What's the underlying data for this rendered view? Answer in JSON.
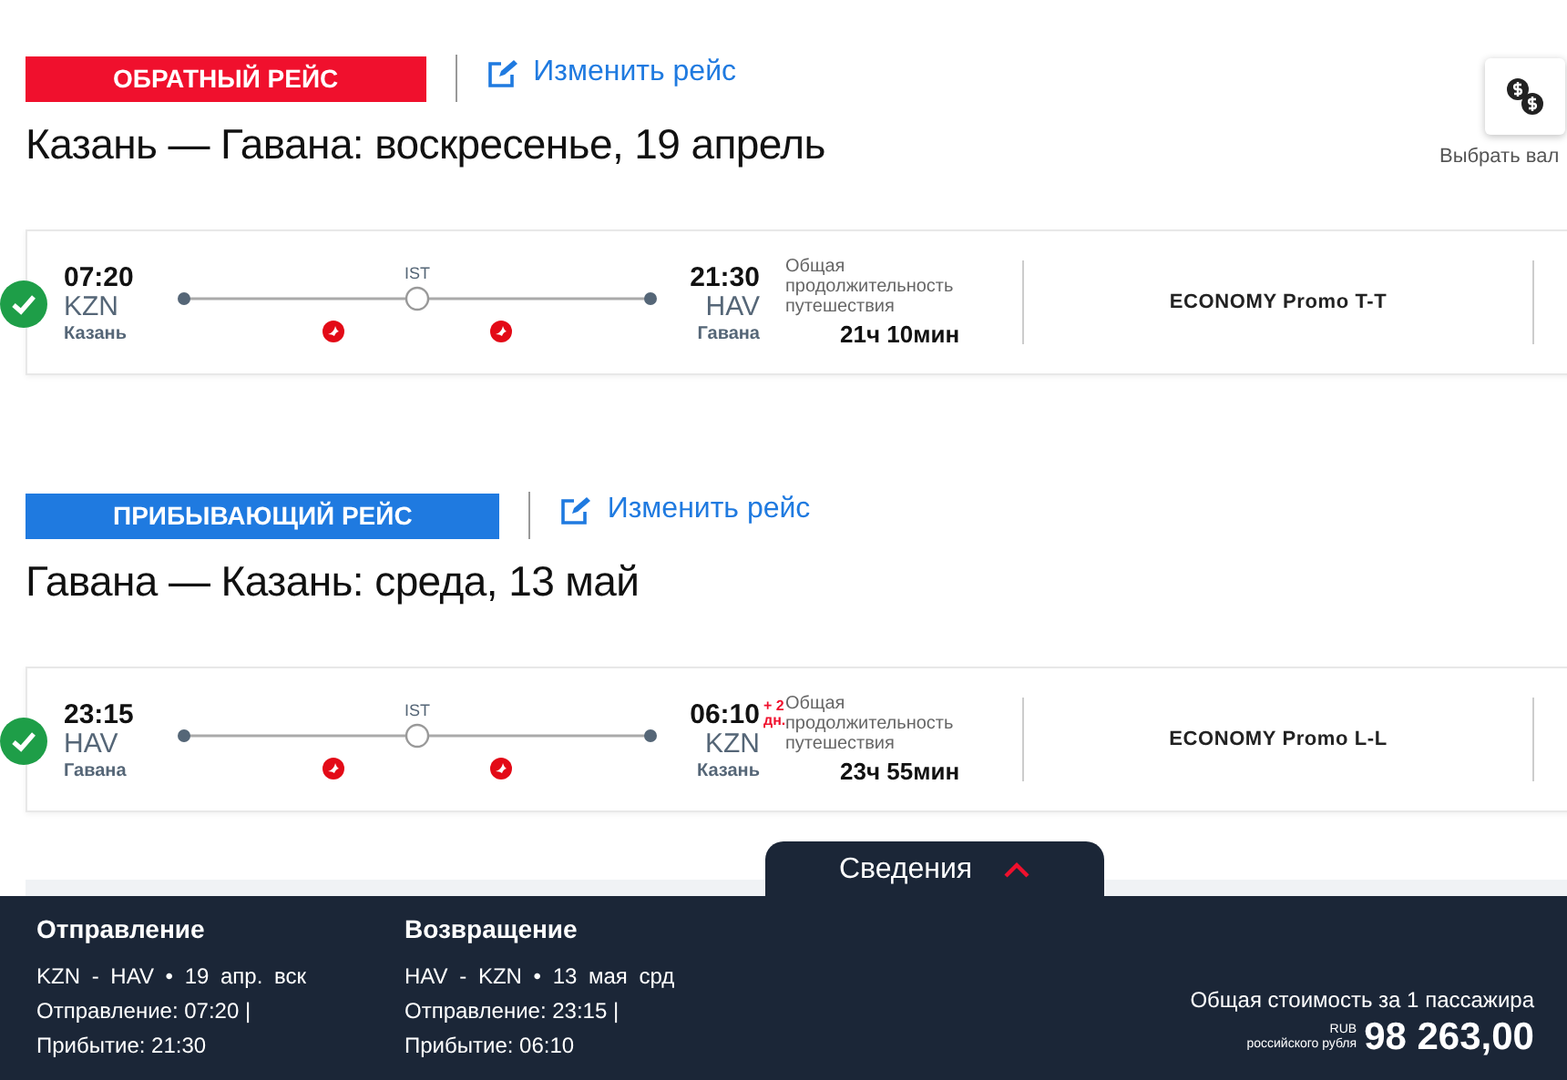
{
  "currency": {
    "label": "Выбрать вал"
  },
  "flights": [
    {
      "kind": "outbound",
      "badge": "ОБРАТНЫЙ РЕЙС",
      "change_link": "Изменить рейс",
      "title": "Казань — Гавана: воскресенье, 19 апрель",
      "selected": true,
      "departure": {
        "time": "07:20",
        "code": "KZN",
        "city": "Казань"
      },
      "stop": "IST",
      "arrival": {
        "time": "21:30",
        "code": "HAV",
        "city": "Гавана"
      },
      "duration_label": "Общая продолжительность путешествия",
      "duration": "21ч 10мин",
      "fare": "ECONOMY Promo T-T"
    },
    {
      "kind": "inbound",
      "badge": "ПРИБЫВАЮЩИЙ РЕЙС",
      "change_link": "Изменить рейс",
      "title": "Гавана — Казань: среда, 13 май",
      "selected": true,
      "departure": {
        "time": "23:15",
        "code": "HAV",
        "city": "Гавана"
      },
      "stop": "IST",
      "arrival": {
        "time": "06:10",
        "code": "KZN",
        "city": "Казань"
      },
      "day_shift": [
        "+ 2",
        "дн."
      ],
      "duration_label": "Общая продолжительность путешествия",
      "duration": "23ч 55мин",
      "fare": "ECONOMY Promo L-L"
    }
  ],
  "summary": {
    "tab": {
      "label": "Сведения",
      "expanded": true
    },
    "columns": [
      {
        "heading": "Отправление",
        "route": "KZN - HAV • 19 апр. вск",
        "departure": "Отправление: 07:20 |",
        "arrival": "Прибытие: 21:30"
      },
      {
        "heading": "Возвращение",
        "route": "HAV - KZN • 13 мая срд",
        "departure": "Отправление: 23:15 |",
        "arrival": "Прибытие: 06:10"
      }
    ],
    "total": {
      "label": "Общая стоимость за 1 пассажира",
      "currency_code": "RUB",
      "currency_name": "российского рубля",
      "amount": "98 263,00"
    }
  }
}
